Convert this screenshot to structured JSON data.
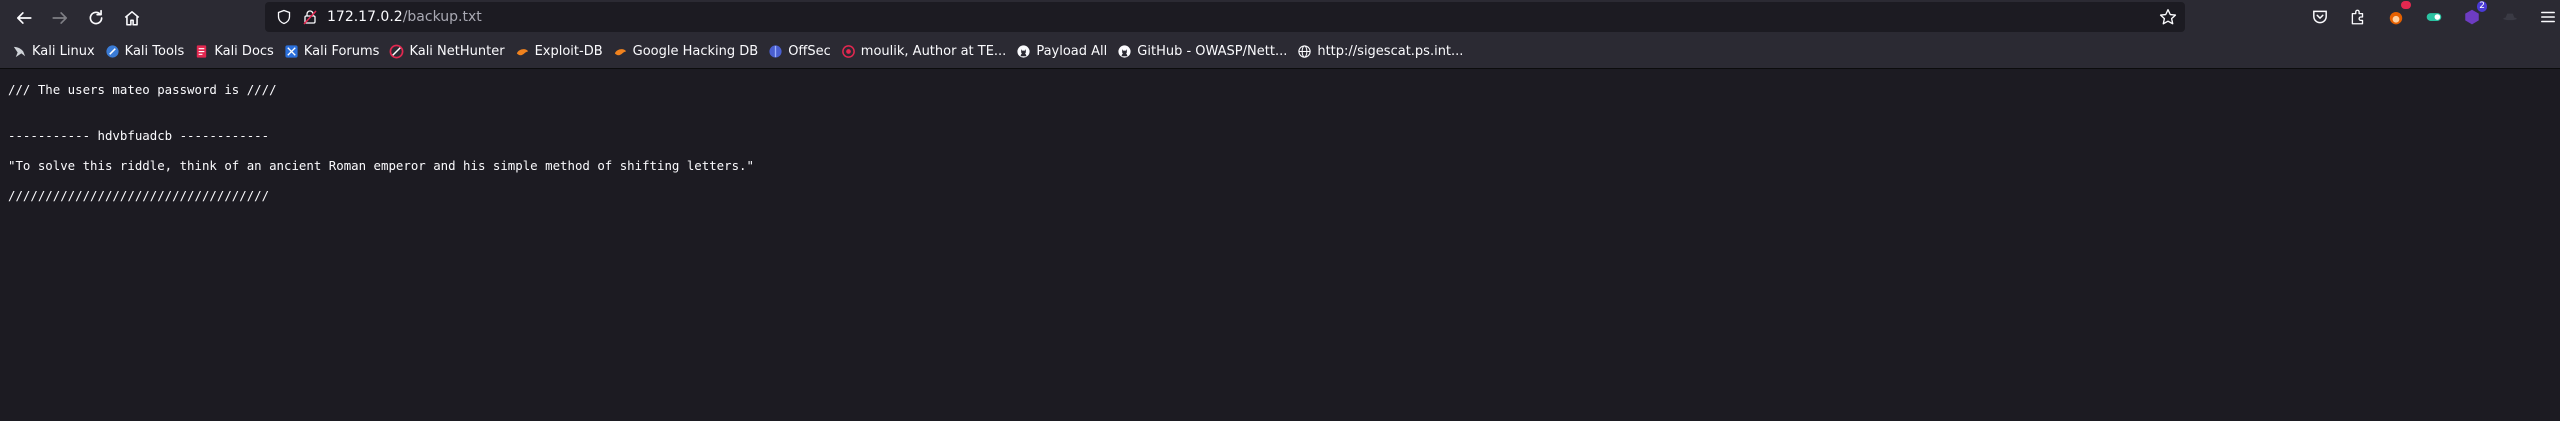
{
  "browser": {
    "url": {
      "host": "172.17.0.2",
      "path": "/backup.txt"
    },
    "extension_badges": {
      "first": "",
      "second": "2"
    }
  },
  "bookmarks": [
    {
      "label": "Kali Linux",
      "icon": "kali-dragon-icon"
    },
    {
      "label": "Kali Tools",
      "icon": "kali-tools-icon"
    },
    {
      "label": "Kali Docs",
      "icon": "kali-docs-icon"
    },
    {
      "label": "Kali Forums",
      "icon": "kali-forums-icon"
    },
    {
      "label": "Kali NetHunter",
      "icon": "nethunter-icon"
    },
    {
      "label": "Exploit-DB",
      "icon": "exploit-db-icon"
    },
    {
      "label": "Google Hacking DB",
      "icon": "ghdb-icon"
    },
    {
      "label": "OffSec",
      "icon": "offsec-icon"
    },
    {
      "label": "moulik, Author at TE...",
      "icon": "globe-red-icon"
    },
    {
      "label": "Payload All",
      "icon": "github-icon"
    },
    {
      "label": "GitHub - OWASP/Nett...",
      "icon": "github-icon"
    },
    {
      "label": "http://sigescat.ps.int...",
      "icon": "globe-icon"
    }
  ],
  "document": {
    "lines": [
      "/// The users mateo password is ////",
      "",
      "",
      "----------- hdvbfuadcb ------------",
      "",
      "\"To solve this riddle, think of an ancient Roman emperor and his simple method of shifting letters.\"",
      "",
      "///////////////////////////////////"
    ]
  }
}
